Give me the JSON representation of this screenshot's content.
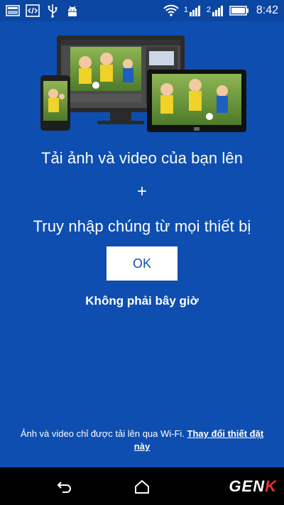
{
  "status_bar": {
    "time": "8:42",
    "signal_1_label": "1",
    "signal_2_label": "2"
  },
  "hero": {
    "image": "photo-of-kids-playing-soccer-on-devices"
  },
  "content": {
    "headline_line1": "Tải ảnh và video của bạn lên",
    "plus": "+",
    "headline_line2": "Truy nhập chúng từ mọi thiết bị",
    "ok_label": "OK",
    "not_now_label": "Không phải bây giờ"
  },
  "footer": {
    "note_text": "Ảnh và video chỉ được tải lên qua Wi-Fi.",
    "link_text": "Thay đổi thiết đặt này"
  },
  "nav_bar": {
    "logo_main": "GEN",
    "logo_accent": "K"
  },
  "colors": {
    "background": "#0e4eb0",
    "button_text": "#1550b0",
    "nav_background": "#000000",
    "logo_accent": "#e3342f"
  }
}
